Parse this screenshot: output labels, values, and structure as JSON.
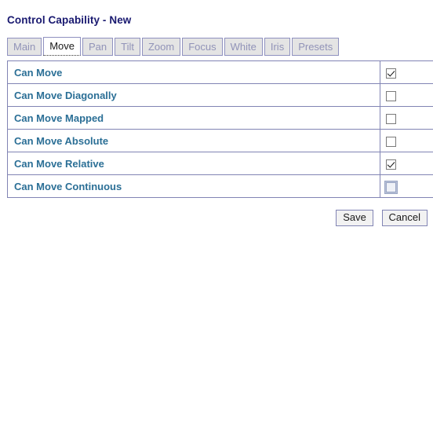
{
  "page": {
    "title": "Control Capability - New"
  },
  "tabs": [
    {
      "label": "Main",
      "active": false
    },
    {
      "label": "Move",
      "active": true
    },
    {
      "label": "Pan",
      "active": false
    },
    {
      "label": "Tilt",
      "active": false
    },
    {
      "label": "Zoom",
      "active": false
    },
    {
      "label": "Focus",
      "active": false
    },
    {
      "label": "White",
      "active": false
    },
    {
      "label": "Iris",
      "active": false
    },
    {
      "label": "Presets",
      "active": false
    }
  ],
  "capabilities": [
    {
      "label": "Can Move",
      "checked": true,
      "focused": false
    },
    {
      "label": "Can Move Diagonally",
      "checked": false,
      "focused": false
    },
    {
      "label": "Can Move Mapped",
      "checked": false,
      "focused": false
    },
    {
      "label": "Can Move Absolute",
      "checked": false,
      "focused": false
    },
    {
      "label": "Can Move Relative",
      "checked": true,
      "focused": false
    },
    {
      "label": "Can Move Continuous",
      "checked": false,
      "focused": true
    }
  ],
  "buttons": {
    "save": "Save",
    "cancel": "Cancel"
  },
  "colors": {
    "title": "#191970",
    "label": "#2b6f96",
    "border": "#8184b4",
    "tab_inactive_bg": "#e4e4e4",
    "tab_inactive_text": "#9193b8",
    "button_bg": "#f2f2f2"
  }
}
